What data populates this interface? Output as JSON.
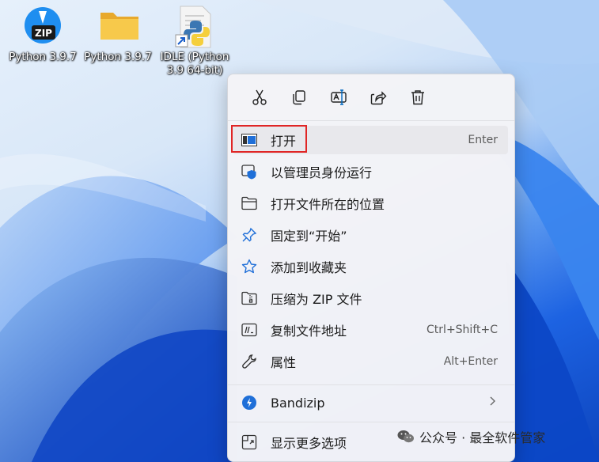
{
  "desktop": {
    "icons": [
      {
        "label": "Python 3.9.7",
        "badge": "ZIP",
        "icon": "bandizip-icon"
      },
      {
        "label": "Python 3.9.7",
        "icon": "folder-icon"
      },
      {
        "label": "IDLE (Python\n3.9 64-bit)",
        "icon": "python-shortcut-icon"
      }
    ]
  },
  "context_menu": {
    "quick_actions": [
      {
        "name": "cut",
        "icon": "scissors-icon"
      },
      {
        "name": "copy",
        "icon": "copy-icon"
      },
      {
        "name": "rename",
        "icon": "rename-icon"
      },
      {
        "name": "share",
        "icon": "share-icon"
      },
      {
        "name": "delete",
        "icon": "trash-icon"
      }
    ],
    "items": [
      {
        "label": "打开",
        "shortcut": "Enter",
        "icon": "open-window-icon",
        "highlighted": true
      },
      {
        "label": "以管理员身份运行",
        "shortcut": "",
        "icon": "shield-icon"
      },
      {
        "label": "打开文件所在的位置",
        "shortcut": "",
        "icon": "folder-open-icon"
      },
      {
        "label": "固定到“开始”",
        "shortcut": "",
        "icon": "pin-icon"
      },
      {
        "label": "添加到收藏夹",
        "shortcut": "",
        "icon": "star-icon"
      },
      {
        "label": "压缩为 ZIP 文件",
        "shortcut": "",
        "icon": "zip-folder-icon"
      },
      {
        "label": "复制文件地址",
        "shortcut": "Ctrl+Shift+C",
        "icon": "copy-path-icon"
      },
      {
        "label": "属性",
        "shortcut": "Alt+Enter",
        "icon": "wrench-icon"
      },
      {
        "label": "Bandizip",
        "shortcut": "",
        "icon": "bandizip-icon",
        "submenu": true
      },
      {
        "label": "显示更多选项",
        "shortcut": "",
        "icon": "more-options-icon"
      }
    ]
  },
  "watermark": {
    "text": "公众号 · 最全软件管家"
  },
  "colors": {
    "highlight_border": "#e02525",
    "accent": "#0067c0",
    "menu_bg": "#f3f3f7"
  }
}
